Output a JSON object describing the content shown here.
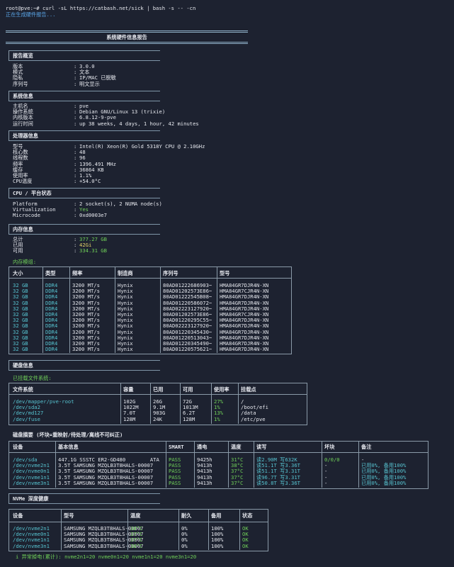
{
  "terminal": {
    "prompt": "root@pve:~#",
    "command": "curl -sL https://catbash.net/sick | bash -s -- -cn",
    "status": "正在生成硬件报告..."
  },
  "report_title": "系统硬件信息报告",
  "overview": {
    "title": "报告概览",
    "rows": [
      {
        "k": "版本",
        "v": "3.0.0"
      },
      {
        "k": "模式",
        "v": "文本"
      },
      {
        "k": "隐私",
        "v": "IP/MAC 已脱敏"
      },
      {
        "k": "序列号",
        "v": "明文显示"
      }
    ]
  },
  "system": {
    "title": "系统信息",
    "rows": [
      {
        "k": "主机名",
        "v": "pve"
      },
      {
        "k": "操作系统",
        "v": "Debian GNU/Linux 13 (trixie)"
      },
      {
        "k": "内核版本",
        "v": "6.8.12-9-pve"
      },
      {
        "k": "运行时间",
        "v": "up 38 weeks, 4 days, 1 hour, 42 minutes"
      }
    ]
  },
  "cpu": {
    "title": "处理器信息",
    "rows": [
      {
        "k": "型号",
        "v": "Intel(R) Xeon(R) Gold 5318Y CPU @ 2.10GHz"
      },
      {
        "k": "核心数",
        "v": "48"
      },
      {
        "k": "线程数",
        "v": "96"
      },
      {
        "k": "频率",
        "v": "1396.491 MHz"
      },
      {
        "k": "缓存",
        "v": "36864 KB"
      },
      {
        "k": "使用率",
        "v": "1.1%"
      },
      {
        "k": "CPU温度",
        "v": "+54.0°C"
      }
    ]
  },
  "platform": {
    "title": "CPU / 平台状态",
    "rows": [
      {
        "k": "Platform",
        "v": "2 socket(s), 2 NUMA node(s)",
        "color": "white"
      },
      {
        "k": "Virtualization",
        "v": "Yes",
        "color": "green"
      },
      {
        "k": "Microcode",
        "v": "0xd0003e7",
        "color": "white"
      }
    ]
  },
  "memory": {
    "title": "内存信息",
    "rows": [
      {
        "k": "总计",
        "v": "377.27 GB",
        "color": "green"
      },
      {
        "k": "已用",
        "v": "42Gi",
        "color": "yellow"
      },
      {
        "k": "可用",
        "v": "334.31 GB",
        "color": "green"
      }
    ],
    "modules_label": "内存模组:",
    "headers": [
      "大小",
      "类型",
      "频率",
      "制造商",
      "序列号",
      "型号"
    ],
    "modules": [
      [
        "32 GB",
        "DDR4",
        "3200 MT/s",
        "Hynix",
        "80AD01222686903~",
        "HMA84GR7DJR4N-XN"
      ],
      [
        "32 GB",
        "DDR4",
        "3200 MT/s",
        "Hynix",
        "80AD01202573E86~",
        "HMA84GR7CJR4N-XN"
      ],
      [
        "32 GB",
        "DDR4",
        "3200 MT/s",
        "Hynix",
        "80AD01222545B08~",
        "HMA84GR7DJR4N-XN"
      ],
      [
        "32 GB",
        "DDR4",
        "3200 MT/s",
        "Hynix",
        "80AD01220586072~",
        "HMA84GR7DJR4N-XN"
      ],
      [
        "32 GB",
        "DDR4",
        "3200 MT/s",
        "Hynix",
        "80AD02223127920~",
        "HMA84GR7DJR4N-XN"
      ],
      [
        "32 GB",
        "DDR4",
        "3200 MT/s",
        "Hynix",
        "80AD01202573E86~",
        "HMA84GR7CJR4N-XN"
      ],
      [
        "32 GB",
        "DDR4",
        "3200 MT/s",
        "Hynix",
        "80AD01220295C55~",
        "HMA84GR7DJR4N-XN"
      ],
      [
        "32 GB",
        "DDR4",
        "3200 MT/s",
        "Hynix",
        "80AD02223127920~",
        "HMA84GR7DJR4N-XN"
      ],
      [
        "32 GB",
        "DDR4",
        "3200 MT/s",
        "Hynix",
        "80AD01220345430~",
        "HMA84GR7DJR4N-XN"
      ],
      [
        "32 GB",
        "DDR4",
        "3200 MT/s",
        "Hynix",
        "80AD01220513043~",
        "HMA84GR7DJR4N-XN"
      ],
      [
        "32 GB",
        "DDR4",
        "3200 MT/s",
        "Hynix",
        "80AD01220345490~",
        "HMA84GR7DJR4N-XN"
      ],
      [
        "32 GB",
        "DDR4",
        "3200 MT/s",
        "Hynix",
        "80AD01220575621~",
        "HMA84GR7DJR4N-XN"
      ]
    ]
  },
  "disk": {
    "title": "硬盘信息",
    "mounted_label": "已挂载文件系统:",
    "fs_headers": [
      "文件系统",
      "容量",
      "已用",
      "可用",
      "使用率",
      "挂载点"
    ],
    "fs": [
      [
        "/dev/mapper/pve-root",
        "102G",
        "26G",
        "72G",
        "27%",
        "/"
      ],
      [
        "/dev/sda2",
        "1022M",
        "9.1M",
        "1013M",
        "1%",
        "/boot/efi"
      ],
      [
        "/dev/md127",
        "7.0T",
        "903G",
        "6.2T",
        "13%",
        "/data"
      ],
      [
        "/dev/fuse",
        "128M",
        "24K",
        "128M",
        "1%",
        "/etc/pve"
      ]
    ],
    "summary_title": "磁盘摘要 (坏块=重映射/待处理/离线不可纠正)",
    "sum_headers": [
      "设备",
      "基本信息",
      "SMART",
      "通电",
      "温度",
      "读写",
      "坏块",
      "备注"
    ],
    "summary": [
      [
        "/dev/sda",
        "447.1G SSSTC ER2-GD480        ATA",
        "PASS",
        "9425h",
        "31°C",
        "读2.90M 写632K",
        "0/0/0",
        "-"
      ],
      [
        "/dev/nvme2n1",
        "3.5T SAMSUNG MZQLB3T8HALS-00007",
        "PASS",
        "9413h",
        "38°C",
        "读51.1T 写3.36T",
        "-",
        "已用0%, 备用100%"
      ],
      [
        "/dev/nvme0n1",
        "3.5T SAMSUNG MZQLB3T8HALS-00007",
        "PASS",
        "9413h",
        "37°C",
        "读51.1T 写3.31T",
        "-",
        "已用0%, 备用100%"
      ],
      [
        "/dev/nvme1n1",
        "3.5T SAMSUNG MZQLB3T8HALS-00007",
        "PASS",
        "9413h",
        "37°C",
        "读96.7T 写3.31T",
        "-",
        "已用0%, 备用100%"
      ],
      [
        "/dev/nvme3n1",
        "3.5T SAMSUNG MZQLB3T8HALS-00007",
        "PASS",
        "9413h",
        "37°C",
        "读50.8T 写3.36T",
        "-",
        "已用0%, 备用100%"
      ]
    ]
  },
  "nvme": {
    "title": "NVMe 深度健康",
    "headers": [
      "设备",
      "型号",
      "温度",
      "耐久",
      "备用",
      "状态"
    ],
    "rows": [
      [
        "/dev/nvme2n1",
        "SAMSUNG MZQLB3T8HALS-00007",
        "38°C",
        "0%",
        "100%",
        "OK"
      ],
      [
        "/dev/nvme0n1",
        "SAMSUNG MZQLB3T8HALS-00007",
        "37°C",
        "0%",
        "100%",
        "OK"
      ],
      [
        "/dev/nvme1n1",
        "SAMSUNG MZQLB3T8HALS-00007",
        "37°C",
        "0%",
        "100%",
        "OK"
      ],
      [
        "/dev/nvme3n1",
        "SAMSUNG MZQLB3T8HALS-00007",
        "36°C",
        "0%",
        "100%",
        "OK"
      ]
    ],
    "footer": "i 异常掉电(累计): nvme2n1=20 nvme0n1=20 nvme1n1=20 nvme3n1=20"
  }
}
